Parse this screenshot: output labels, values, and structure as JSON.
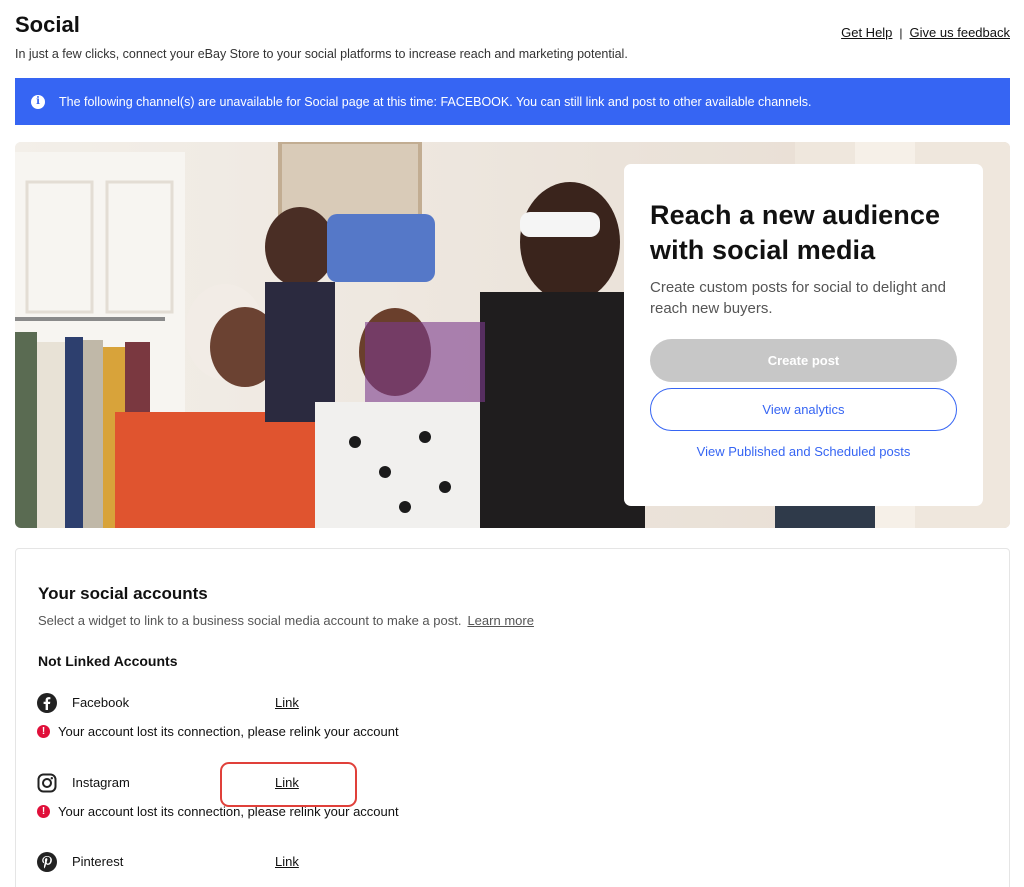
{
  "header": {
    "title": "Social",
    "subtitle": "In just a few clicks, connect your eBay Store to your social platforms to increase reach and marketing potential.",
    "get_help": "Get Help",
    "separator": "|",
    "feedback": "Give us feedback"
  },
  "alert": {
    "icon": "info-icon",
    "text": "The following channel(s) are unavailable for Social page at this time: FACEBOOK. You can still link and post to other available channels.",
    "color": "#3665f3"
  },
  "hero": {
    "title": "Reach a new audience with social media",
    "description": "Create custom posts for social to delight and reach new buyers.",
    "create_post": "Create post",
    "view_analytics": "View analytics",
    "view_posts": "View Published and Scheduled posts"
  },
  "accounts": {
    "title": "Your social accounts",
    "description": "Select a widget to link to a business social media account to make a post.",
    "learn_more": "Learn more",
    "not_linked_title": "Not Linked Accounts",
    "items": [
      {
        "name": "Facebook",
        "icon": "facebook-icon",
        "link": "Link",
        "error": "Your account lost its connection, please relink your account"
      },
      {
        "name": "Instagram",
        "icon": "instagram-icon",
        "link": "Link",
        "error": "Your account lost its connection, please relink your account"
      },
      {
        "name": "Pinterest",
        "icon": "pinterest-icon",
        "link": "Link"
      }
    ]
  },
  "colors": {
    "accent": "#3665f3",
    "error": "#e0103a",
    "highlight": "#e0403a"
  }
}
